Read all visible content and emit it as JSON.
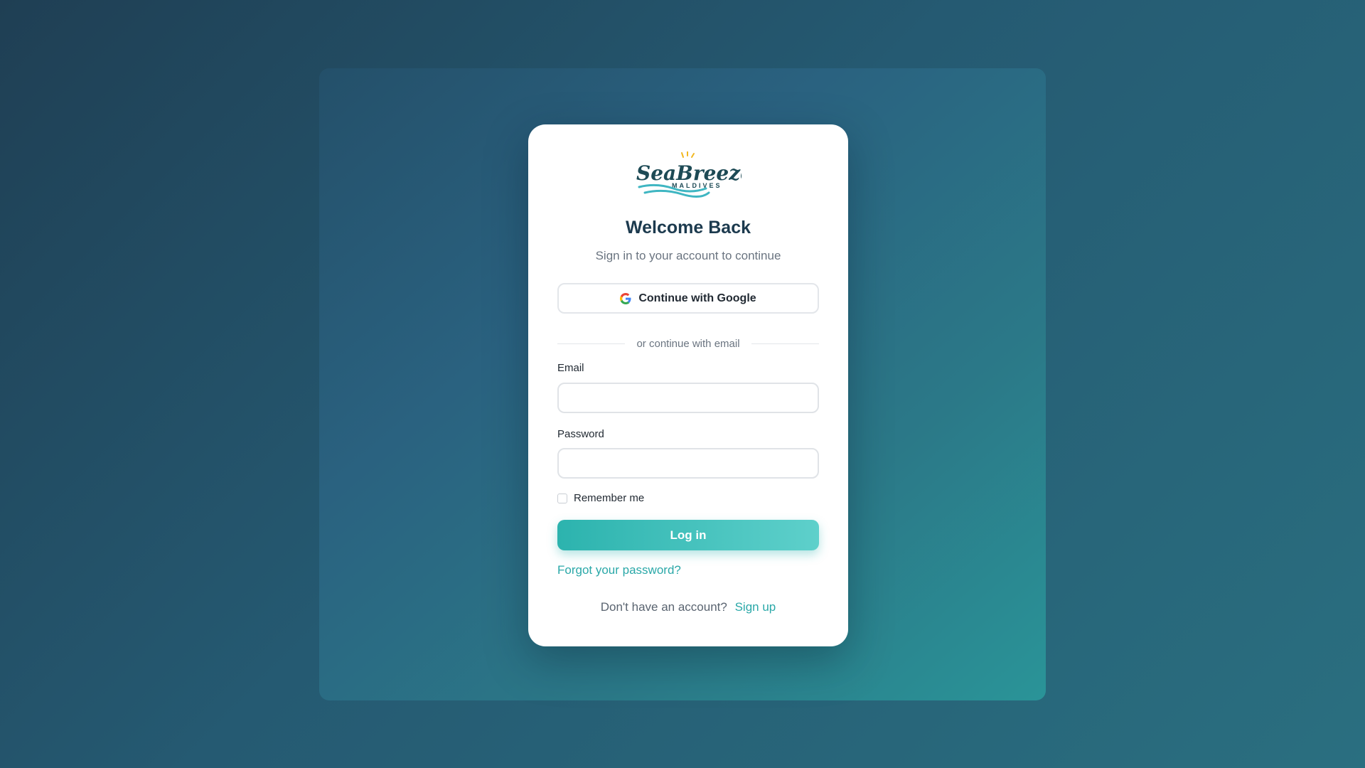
{
  "logo": {
    "text": "SeaBreeze",
    "subtext": "MALDIVES"
  },
  "heading": {
    "title": "Welcome Back",
    "subtitle": "Sign in to your account to continue"
  },
  "google": {
    "label": "Continue with Google"
  },
  "divider": {
    "text": "or continue with email"
  },
  "form": {
    "email_label": "Email",
    "email_value": "",
    "password_label": "Password",
    "password_value": "",
    "remember_label": "Remember me",
    "remember_checked": false,
    "login_label": "Log in",
    "forgot_label": "Forgot your password?"
  },
  "signup": {
    "prompt": "Don't have an account?",
    "link_label": "Sign up"
  },
  "colors": {
    "accent": "#2cb3ae",
    "title": "#1c3a4e",
    "link": "#2aa8a8"
  }
}
